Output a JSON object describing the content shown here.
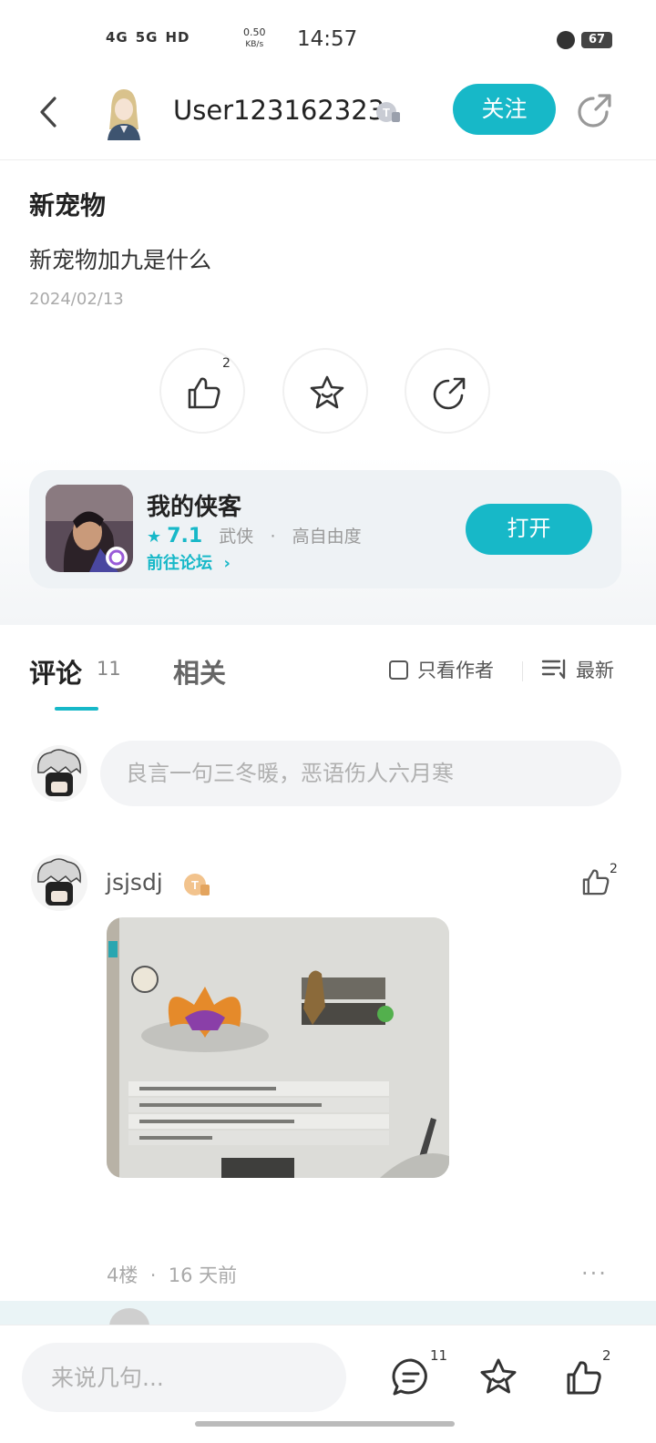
{
  "status_bar": {
    "network": "4G  5G  HD",
    "speed_value": "0.50",
    "speed_unit": "KB/s",
    "time": "14:57",
    "battery": "67"
  },
  "header": {
    "username": "User123162323",
    "follow_label": "关注",
    "level_badge": "T3"
  },
  "post": {
    "title": "新宠物",
    "body": "新宠物加九是什么",
    "date": "2024/02/13",
    "like_count": "2"
  },
  "game_card": {
    "name": "我的侠客",
    "score": "7.1",
    "tag1": "武侠",
    "separator": "·",
    "tag2": "高自由度",
    "forum_link": "前往论坛",
    "open_label": "打开"
  },
  "tabs": {
    "comments_label": "评论",
    "comments_count": "11",
    "related_label": "相关",
    "only_author_label": "只看作者",
    "sort_label": "最新"
  },
  "comment_input": {
    "placeholder": "良言一句三冬暖，恶语伤人六月寒"
  },
  "comments": [
    {
      "username": "jsjsdj",
      "level_badge": "T5",
      "like_count": "2",
      "floor": "4楼",
      "separator": "·",
      "time_ago": "16 天前",
      "more": "···"
    }
  ],
  "bottom_bar": {
    "input_placeholder": "来说几句...",
    "comment_count": "11",
    "like_count": "2"
  },
  "colors": {
    "accent": "#17b8c8",
    "card_bg": "#eef2f5",
    "muted_text": "#aaaaaa"
  },
  "icons": {
    "back": "chevron-left-icon",
    "share": "share-icon",
    "like": "thumbs-up-icon",
    "favorite": "star-icon",
    "comment": "comment-bubble-icon",
    "sort": "sort-lines-icon"
  }
}
